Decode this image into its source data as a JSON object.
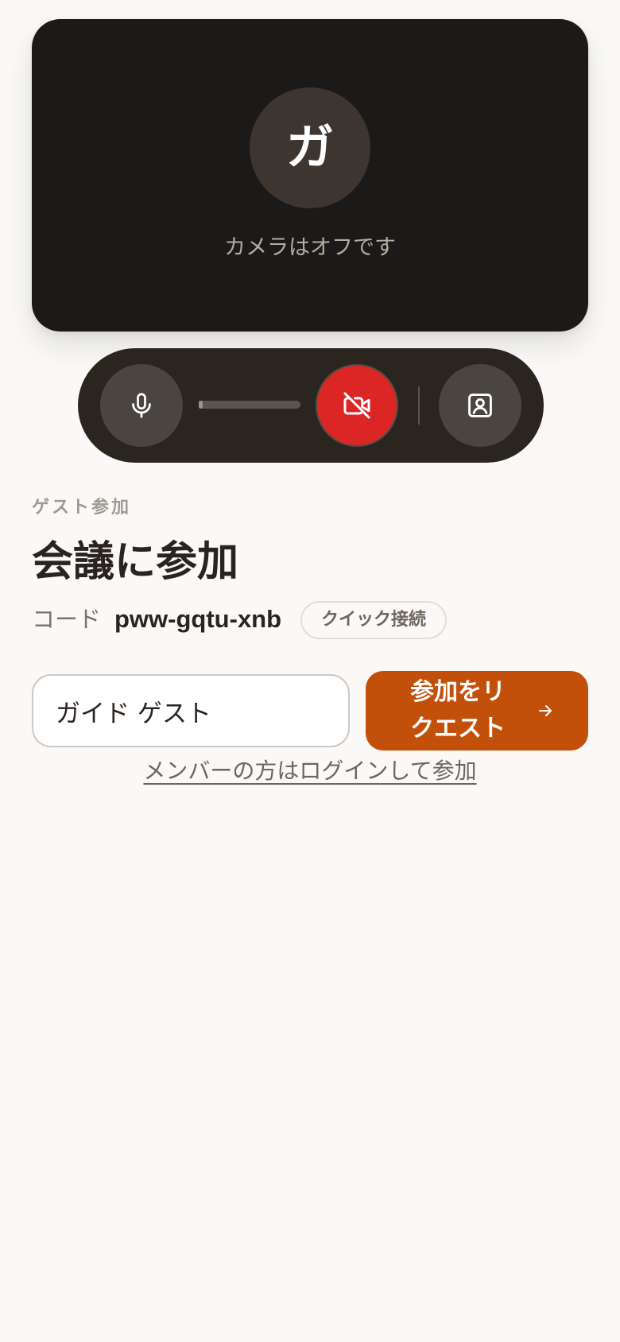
{
  "preview": {
    "avatar_initial": "ガ",
    "camera_status": "カメラはオフです"
  },
  "controls": {
    "mic_icon": "microphone-icon",
    "camera_icon": "video-off-icon",
    "background_icon": "person-portrait-icon",
    "mic_level": 0.04
  },
  "eyebrow": "ゲスト参加",
  "title": "会議に参加",
  "code": {
    "label": "コード",
    "value": "pww-gqtu-xnb",
    "badge": "クイック接続"
  },
  "name_input": {
    "value": "ガイド ゲスト"
  },
  "join_button": {
    "label": "参加をリクエスト",
    "icon": "arrow-right-icon"
  },
  "login_link": "メンバーの方はログインして参加",
  "colors": {
    "accent": "#c2500b",
    "danger": "#dc2626",
    "preview_bg": "#1c1a18",
    "page_bg": "#faf9f7"
  }
}
